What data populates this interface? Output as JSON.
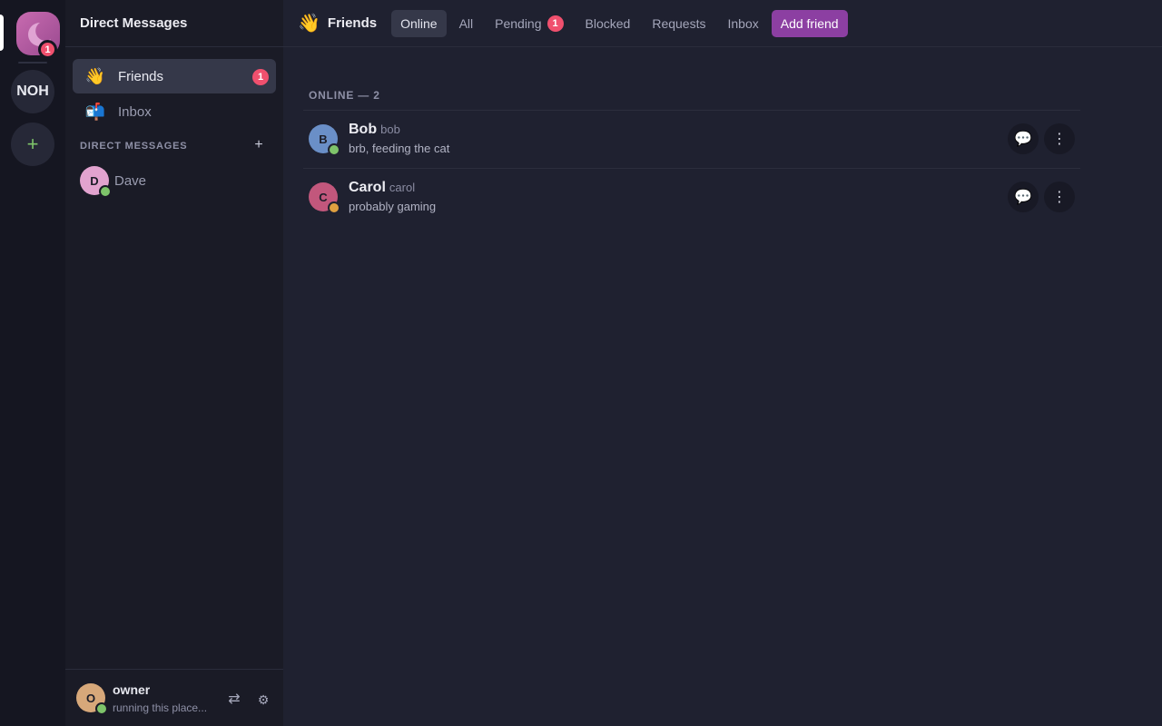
{
  "rail": {
    "home_badge": "1",
    "server_label": "NOH",
    "add_label": "+"
  },
  "sidebar": {
    "title": "Direct Messages",
    "nav": [
      {
        "emoji": "👋",
        "label": "Friends",
        "badge": "1"
      },
      {
        "emoji": "📬",
        "label": "Inbox"
      }
    ],
    "dm_header": "DIRECT MESSAGES",
    "dm_add": "+",
    "dms": [
      {
        "initial": "D",
        "name": "Dave",
        "avatar_color": "#e2a3cf",
        "status_color": "#7ec46a"
      }
    ]
  },
  "user": {
    "initial": "O",
    "name": "owner",
    "status": "running this place...",
    "avatar_color": "#d7a87a",
    "status_color": "#7ec46a",
    "switch_icon": "⇄",
    "settings_icon": "⚙"
  },
  "topbar": {
    "emoji": "👋",
    "title": "Friends",
    "tabs": [
      {
        "label": "Online"
      },
      {
        "label": "All"
      },
      {
        "label": "Pending",
        "badge": "1"
      },
      {
        "label": "Blocked"
      },
      {
        "label": "Requests"
      },
      {
        "label": "Inbox"
      },
      {
        "label": "Add friend"
      }
    ]
  },
  "main": {
    "section_label": "ONLINE — 2",
    "friends": [
      {
        "initial": "B",
        "name": "Bob",
        "username": "bob",
        "status": "brb, feeding the cat",
        "avatar_color": "#6a8fc7",
        "status_color": "#7ec46a"
      },
      {
        "initial": "C",
        "name": "Carol",
        "username": "carol",
        "status": "probably gaming",
        "avatar_color": "#c2577c",
        "status_color": "#e0a040"
      }
    ],
    "message_icon": "💬",
    "more_icon": "⋮"
  },
  "colors": {
    "accent": "#8c3fa2",
    "badge": "#f0506e",
    "online": "#7ec46a",
    "idle": "#e0a040"
  }
}
